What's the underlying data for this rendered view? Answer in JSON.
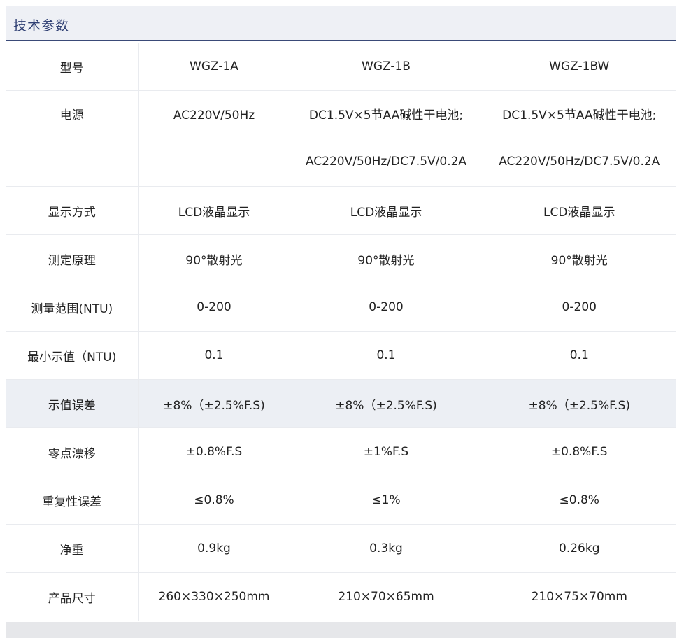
{
  "section": {
    "title": "技术参数"
  },
  "table": {
    "rows": [
      {
        "label": "型号",
        "values": [
          "WGZ-1A",
          "WGZ-1B",
          "WGZ-1BW"
        ]
      },
      {
        "label": "电源",
        "values": [
          [
            "AC220V/50Hz"
          ],
          [
            "DC1.5V×5节AA碱性干电池;",
            "AC220V/50Hz/DC7.5V/0.2A"
          ],
          [
            "DC1.5V×5节AA碱性干电池;",
            "AC220V/50Hz/DC7.5V/0.2A"
          ]
        ]
      },
      {
        "label": "显示方式",
        "values": [
          "LCD液晶显示",
          "LCD液晶显示",
          "LCD液晶显示"
        ]
      },
      {
        "label": "测定原理",
        "values": [
          "90°散射光",
          "90°散射光",
          "90°散射光"
        ]
      },
      {
        "label": "测量范围(NTU)",
        "values": [
          "0-200",
          "0-200",
          "0-200"
        ]
      },
      {
        "label": "最小示值（NTU)",
        "values": [
          "0.1",
          "0.1",
          "0.1"
        ]
      },
      {
        "label": "示值误差",
        "values": [
          "±8%（±2.5%F.S)",
          "±8%（±2.5%F.S)",
          "±8%（±2.5%F.S)"
        ]
      },
      {
        "label": "零点漂移",
        "values": [
          "±0.8%F.S",
          "±1%F.S",
          "±0.8%F.S"
        ]
      },
      {
        "label": "重复性误差",
        "values": [
          "≤0.8%",
          "≤1%",
          "≤0.8%"
        ]
      },
      {
        "label": "净重",
        "values": [
          "0.9kg",
          "0.3kg",
          "0.26kg"
        ]
      },
      {
        "label": "产品尺寸",
        "values": [
          "260×330×250mm",
          "210×70×65mm",
          "210×75×70mm"
        ]
      }
    ]
  },
  "colors": {
    "header_bg": "#eef0f5",
    "header_text": "#2f3f73",
    "highlight_row": "#eceff4",
    "footer": "#e6e7ea"
  }
}
